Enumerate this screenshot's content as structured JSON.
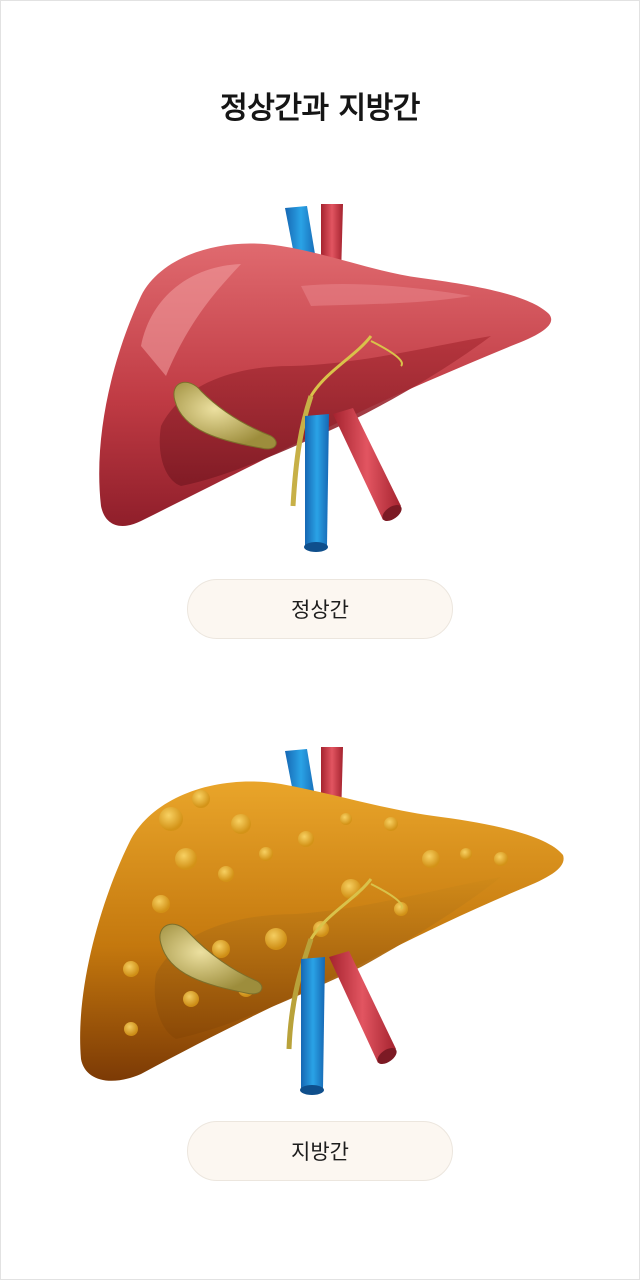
{
  "page": {
    "title": "정상간과 지방간"
  },
  "normal_liver": {
    "label": "정상간"
  },
  "fatty_liver": {
    "label": "지방간"
  },
  "colors": {
    "normal_liver": "#c3434b",
    "fatty_liver": "#c67c12",
    "vein": "#1f8ed6",
    "artery": "#cf3b47",
    "gallbladder": "#c6b85e"
  }
}
